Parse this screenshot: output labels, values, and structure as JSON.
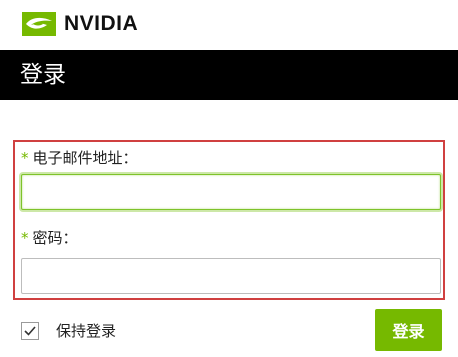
{
  "brand": {
    "name": "NVIDIA",
    "logo_icon": "nvidia-eye-logo",
    "accent_color": "#76b900"
  },
  "header": {
    "title": "登录"
  },
  "form": {
    "email": {
      "required_mark": "*",
      "label": "电子邮件地址：",
      "value": "",
      "focused": true
    },
    "password": {
      "required_mark": "*",
      "label": "密码：",
      "value": ""
    },
    "highlight_color": "#d04040"
  },
  "footer": {
    "remember": {
      "label": "保持登录",
      "checked": true
    },
    "submit_label": "登录"
  }
}
